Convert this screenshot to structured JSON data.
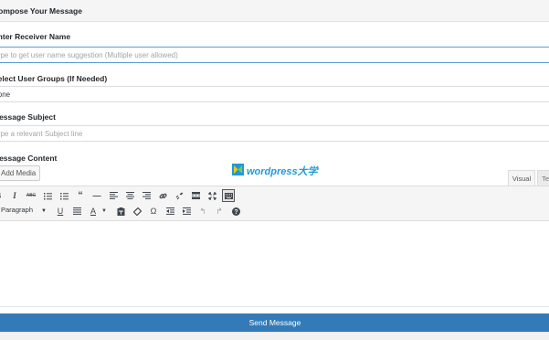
{
  "panel": {
    "title": "Compose Your Message"
  },
  "receiver": {
    "label": "Enter Receiver Name",
    "placeholder": "Type to get user name suggestion (Multiple user allowed)"
  },
  "groups": {
    "label": "Select User Groups (If Needed)",
    "value": "None"
  },
  "subject": {
    "label": "Message Subject",
    "placeholder": "Type a relevant Subject line"
  },
  "content": {
    "label": "Message Content",
    "add_media_label": "Add Media",
    "watermark_text": "wordpress大学",
    "tabs": [
      {
        "label": "Visual"
      },
      {
        "label": "Text"
      }
    ],
    "toolbar_row1": [
      "bold-icon",
      "italic-icon",
      "strikethrough-icon",
      "bullet-list-icon",
      "numbered-list-icon",
      "blockquote-icon",
      "horizontal-line-icon",
      "align-left-icon",
      "align-center-icon",
      "align-right-icon",
      "link-icon",
      "unlink-icon",
      "read-more-icon",
      "fullscreen-icon",
      "toolbar-toggle-icon"
    ],
    "toolbar_row2": [
      "underline-icon",
      "justify-icon",
      "text-color-icon",
      "paste-text-icon",
      "clear-formatting-icon",
      "special-character-icon",
      "outdent-icon",
      "indent-icon",
      "undo-icon",
      "redo-icon",
      "help-icon"
    ],
    "format_select": "Paragraph"
  },
  "send_button": {
    "label": "Send Message"
  },
  "colors": {
    "accent": "#337ab7",
    "watermark": "#1f9ad6",
    "focus_border": "#5b9dd9"
  }
}
